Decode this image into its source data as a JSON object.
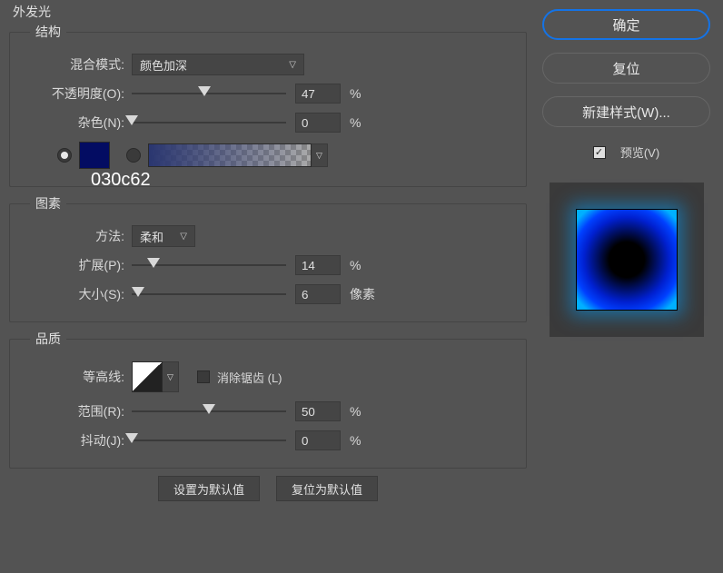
{
  "title": "外发光",
  "structure": {
    "legend": "结构",
    "blend_label": "混合模式:",
    "blend_value": "颜色加深",
    "opacity_label": "不透明度(O):",
    "opacity_value": "47",
    "opacity_unit": "%",
    "opacity_pct": 47,
    "noise_label": "杂色(N):",
    "noise_value": "0",
    "noise_unit": "%",
    "noise_pct": 0,
    "color_hex": "030c62",
    "color_swatch": "#030c62"
  },
  "elements": {
    "legend": "图素",
    "technique_label": "方法:",
    "technique_value": "柔和",
    "spread_label": "扩展(P):",
    "spread_value": "14",
    "spread_unit": "%",
    "spread_pct": 14,
    "size_label": "大小(S):",
    "size_value": "6",
    "size_unit": "像素",
    "size_pct": 4
  },
  "quality": {
    "legend": "品质",
    "contour_label": "等高线:",
    "antialias_label": "消除锯齿 (L)",
    "range_label": "范围(R):",
    "range_value": "50",
    "range_unit": "%",
    "range_pct": 50,
    "jitter_label": "抖动(J):",
    "jitter_value": "0",
    "jitter_unit": "%",
    "jitter_pct": 0
  },
  "bottom": {
    "default_btn": "设置为默认值",
    "reset_btn": "复位为默认值"
  },
  "right": {
    "ok": "确定",
    "reset": "复位",
    "newstyle": "新建样式(W)...",
    "preview_label": "预览(V)"
  }
}
